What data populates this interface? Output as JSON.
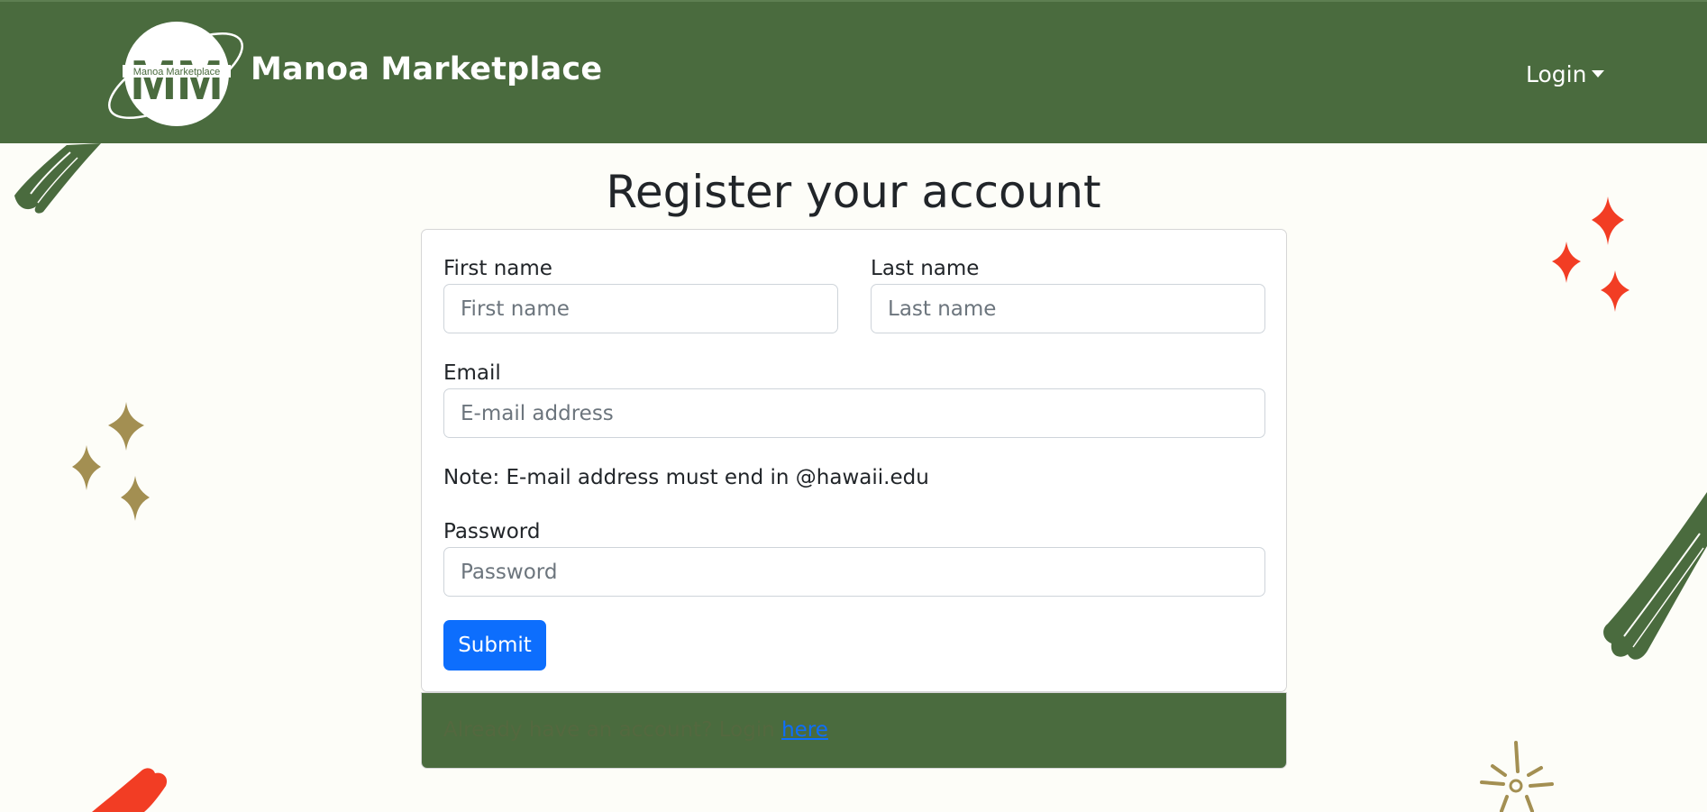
{
  "navbar": {
    "brand": "Manoa Marketplace",
    "logo_text": "Manoa Marketplace",
    "logo_letters": "MM",
    "login_label": "Login"
  },
  "page": {
    "title": "Register your account"
  },
  "form": {
    "first_name_label": "First name",
    "first_name_placeholder": "First name",
    "last_name_label": "Last name",
    "last_name_placeholder": "Last name",
    "email_label": "Email",
    "email_placeholder": "E-mail address",
    "note": "Note: E-mail address must end in @hawaii.edu",
    "password_label": "Password",
    "password_placeholder": "Password",
    "submit_label": "Submit"
  },
  "footer": {
    "text": "Already have an account? Login ",
    "link_text": "here"
  },
  "colors": {
    "navbar_green": "#4a6b3e",
    "primary_blue": "#0d6efd",
    "sparkle_red": "#f23d24",
    "sparkle_olive": "#a38f52"
  }
}
